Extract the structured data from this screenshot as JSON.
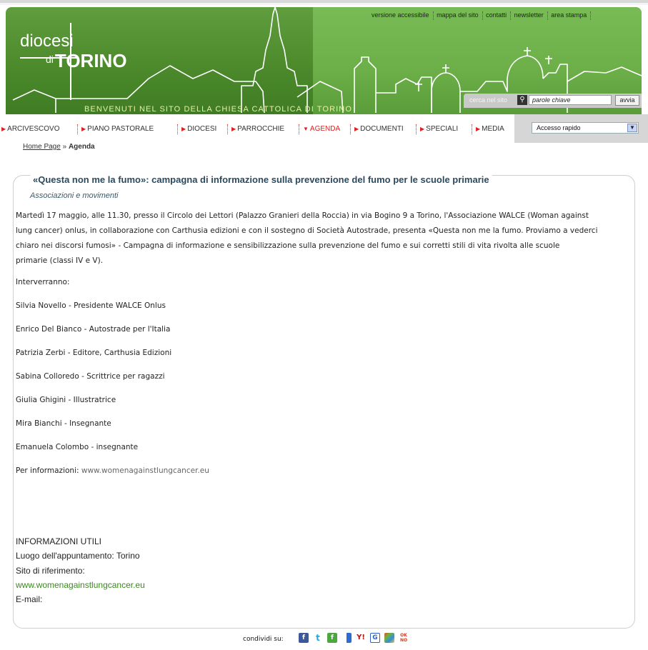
{
  "header": {
    "logo_line1": "diocesi",
    "logo_di": "di",
    "logo_line2": "TORINO",
    "welcome": "BENVENUTI NEL SITO DELLA CHIESA CATTOLICA DI TORINO",
    "utility_links": [
      "versione accessibile",
      "mappa del sito",
      "contatti",
      "newsletter",
      "area stampa"
    ]
  },
  "search": {
    "label": "cerca nel sito",
    "placeholder": "parole chiave",
    "button": "avvia"
  },
  "nav": {
    "items": [
      "ARCIVESCOVO",
      "PIANO PASTORALE",
      "DIOCESI",
      "PARROCCHIE",
      "AGENDA",
      "DOCUMENTI",
      "SPECIALI",
      "MEDIA"
    ],
    "active": "AGENDA",
    "quick_access": "Accesso rapido"
  },
  "breadcrumb": {
    "home": "Home Page",
    "separator": "»",
    "current": "Agenda"
  },
  "article": {
    "title": "«Questa non me la fumo»: campagna di informazione sulla prevenzione del fumo per le scuole primarie",
    "category": "Associazioni e movimenti",
    "intro_lines": [
      "Martedì 17 maggio, alle 11.30, presso il Circolo dei Lettori (Palazzo Granieri della Roccia) in via Bogino 9 a Torino, l'Associazione WALCE (Woman against",
      "lung cancer) onlus, in collaborazione con Carthusia edizioni e con il sostegno di Società Autostrade, presenta «Questa non me la fumo. Proviamo a vederci",
      "chiaro nei discorsi fumosi» - Campagna di informazione e sensibilizzazione sulla prevenzione del fumo e  sui corretti stili di vita rivolta alle scuole",
      "primarie (classi IV e V)."
    ],
    "speakers_heading": "Interverranno:",
    "speakers": [
      "Silvia Novello - Presidente WALCE Onlus",
      "Enrico Del Bianco - Autostrade per l'Italia",
      "Patrizia Zerbi - Editore, Carthusia Edizioni",
      "Sabina Colloredo - Scrittrice per ragazzi",
      "Giulia Ghigini - Illustratrice",
      "Mira Bianchi - Insegnante",
      "Emanuela Colombo - insegnante"
    ],
    "info_label": "Per informazioni:",
    "info_link": "www.womenagainstlungcancer.eu"
  },
  "useful_info": {
    "heading": "INFORMAZIONI UTILI",
    "place": "Luogo dell'appuntamento: Torino",
    "site_label": "Sito di riferimento:",
    "site_link": "www.womenagainstlungcancer.eu",
    "email_label": "E-mail:"
  },
  "share": {
    "label": "condividi su:",
    "icons": [
      "facebook-icon",
      "twitter-icon",
      "friendfeed-icon",
      "delicious-icon",
      "yahoo-icon",
      "google-icon",
      "windows-live-icon",
      "oknotizie-icon"
    ]
  },
  "colors": {
    "header_green": "#4c8a2c",
    "nav_active": "#d22222",
    "title_blue": "#2b4a5e",
    "link_green": "#3a8a1e"
  }
}
